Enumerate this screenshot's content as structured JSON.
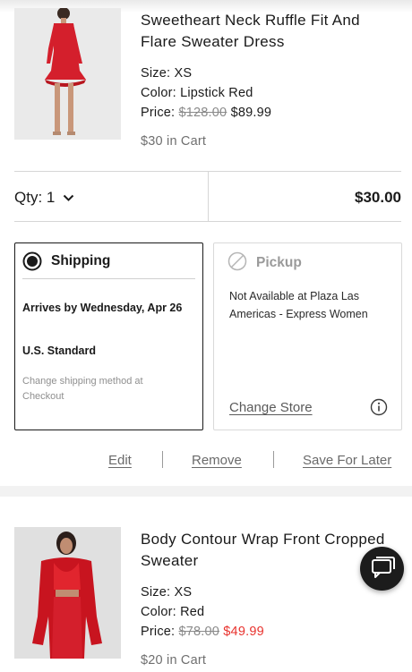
{
  "items": [
    {
      "title": "Sweetheart Neck Ruffle Fit And Flare Sweater Dress",
      "size": "Size: XS",
      "color": "Color: Lipstick Red",
      "price_label": "Price:",
      "price_original": "$128.00",
      "price_sale": "$89.99",
      "price_sale_color": "#1a1a1a",
      "in_cart": "$30 in Cart",
      "image": "red-ruffle-dress-photo"
    },
    {
      "title": "Body Contour Wrap Front Cropped Sweater",
      "size": "Size: XS",
      "color": "Color: Red",
      "price_label": "Price:",
      "price_original": "$78.00",
      "price_sale": "$49.99",
      "price_sale_color": "#e8322d",
      "in_cart": "$20 in Cart",
      "image": "red-wrap-sweater-photo"
    }
  ],
  "qty": {
    "label": "Qty: 1",
    "icon": "chevron-down-icon"
  },
  "line_total": "$30.00",
  "shipping": {
    "title": "Shipping",
    "selected": true,
    "arrives": "Arrives by Wednesday, Apr 26",
    "method": "U.S. Standard",
    "note": "Change shipping method at Checkout"
  },
  "pickup": {
    "title": "Pickup",
    "enabled": false,
    "availability": "Not Available at Plaza Las Americas - Express Women",
    "change_store": "Change Store",
    "info_icon": "info-icon"
  },
  "actions": {
    "edit": "Edit",
    "remove": "Remove",
    "save_for_later": "Save For Later"
  },
  "chat": {
    "icon": "chat-icon"
  },
  "colors": {
    "sale_red": "#e8322d",
    "dress_red": "#d41f2c"
  }
}
